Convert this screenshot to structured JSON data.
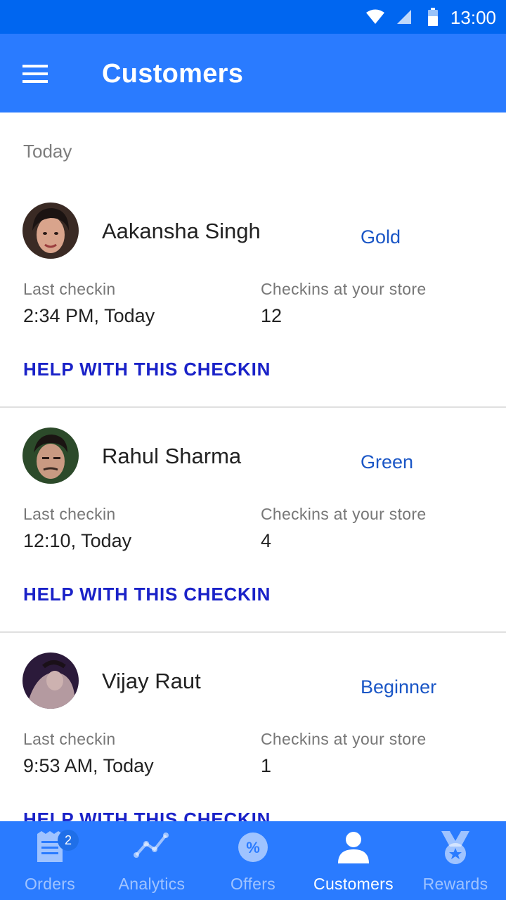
{
  "status": {
    "time": "13:00"
  },
  "appbar": {
    "title": "Customers"
  },
  "section": {
    "label": "Today"
  },
  "customers": [
    {
      "name": "Aakansha Singh",
      "tier": "Gold",
      "last_checkin_label": "Last checkin",
      "last_checkin": "2:34 PM, Today",
      "checkins_label": "Checkins at your store",
      "checkins": "12",
      "action": "HELP WITH THIS CHECKIN"
    },
    {
      "name": "Rahul Sharma",
      "tier": "Green",
      "last_checkin_label": "Last checkin",
      "last_checkin": "12:10, Today",
      "checkins_label": "Checkins at your store",
      "checkins": "4",
      "action": "HELP WITH THIS CHECKIN"
    },
    {
      "name": "Vijay Raut",
      "tier": "Beginner",
      "last_checkin_label": "Last checkin",
      "last_checkin": "9:53 AM, Today",
      "checkins_label": "Checkins at your store",
      "checkins": "1",
      "action": "HELP WITH THIS CHECKIN"
    }
  ],
  "nav": {
    "items": [
      {
        "label": "Orders",
        "icon": "receipt-icon",
        "badge": "2"
      },
      {
        "label": "Analytics",
        "icon": "analytics-icon"
      },
      {
        "label": "Offers",
        "icon": "offers-icon"
      },
      {
        "label": "Customers",
        "icon": "person-icon",
        "active": true
      },
      {
        "label": "Rewards",
        "icon": "medal-icon"
      }
    ]
  },
  "colors": {
    "statusbar": "#0066f0",
    "primary": "#2a7bff",
    "tier": "#1a56c6",
    "action": "#1a22c8"
  }
}
